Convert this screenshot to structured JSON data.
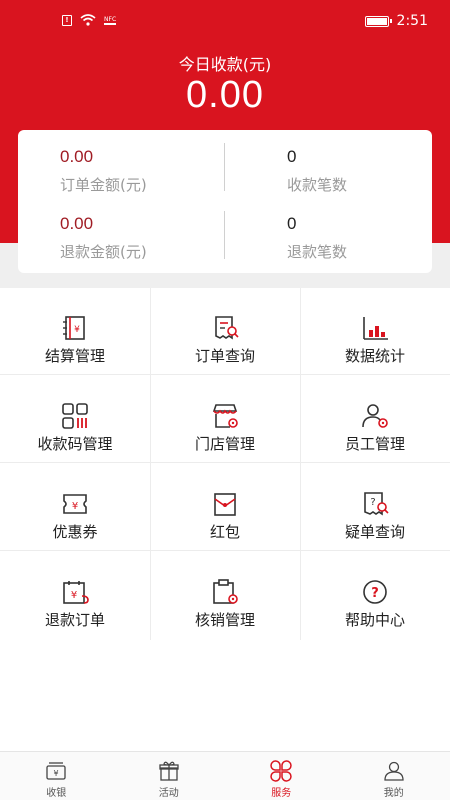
{
  "status_bar": {
    "time": "2:51",
    "nfc_label": "NFC"
  },
  "summary": {
    "title": "今日收款(元)",
    "amount": "0.00",
    "stats": [
      {
        "value": "0.00",
        "label": "订单金额(元)"
      },
      {
        "value": "0",
        "label": "收款笔数"
      },
      {
        "value": "0.00",
        "label": "退款金额(元)"
      },
      {
        "value": "0",
        "label": "退款笔数"
      }
    ]
  },
  "grid": [
    {
      "label": "结算管理",
      "icon": "ledger-icon"
    },
    {
      "label": "订单查询",
      "icon": "order-search-icon"
    },
    {
      "label": "数据统计",
      "icon": "bar-chart-icon"
    },
    {
      "label": "收款码管理",
      "icon": "qr-code-icon"
    },
    {
      "label": "门店管理",
      "icon": "store-icon"
    },
    {
      "label": "员工管理",
      "icon": "staff-icon"
    },
    {
      "label": "优惠券",
      "icon": "coupon-icon"
    },
    {
      "label": "红包",
      "icon": "red-envelope-icon"
    },
    {
      "label": "疑单查询",
      "icon": "doubtful-order-icon"
    },
    {
      "label": "退款订单",
      "icon": "refund-order-icon"
    },
    {
      "label": "核销管理",
      "icon": "verification-icon"
    },
    {
      "label": "帮助中心",
      "icon": "help-icon"
    }
  ],
  "tabs": [
    {
      "label": "收银",
      "icon": "cashier-icon",
      "active": false
    },
    {
      "label": "活动",
      "icon": "gift-icon",
      "active": false
    },
    {
      "label": "服务",
      "icon": "service-icon",
      "active": true
    },
    {
      "label": "我的",
      "icon": "profile-icon",
      "active": false
    }
  ],
  "colors": {
    "brand": "#d9141f",
    "value_red": "#a01c24",
    "label_grey": "#9a9a9a"
  }
}
